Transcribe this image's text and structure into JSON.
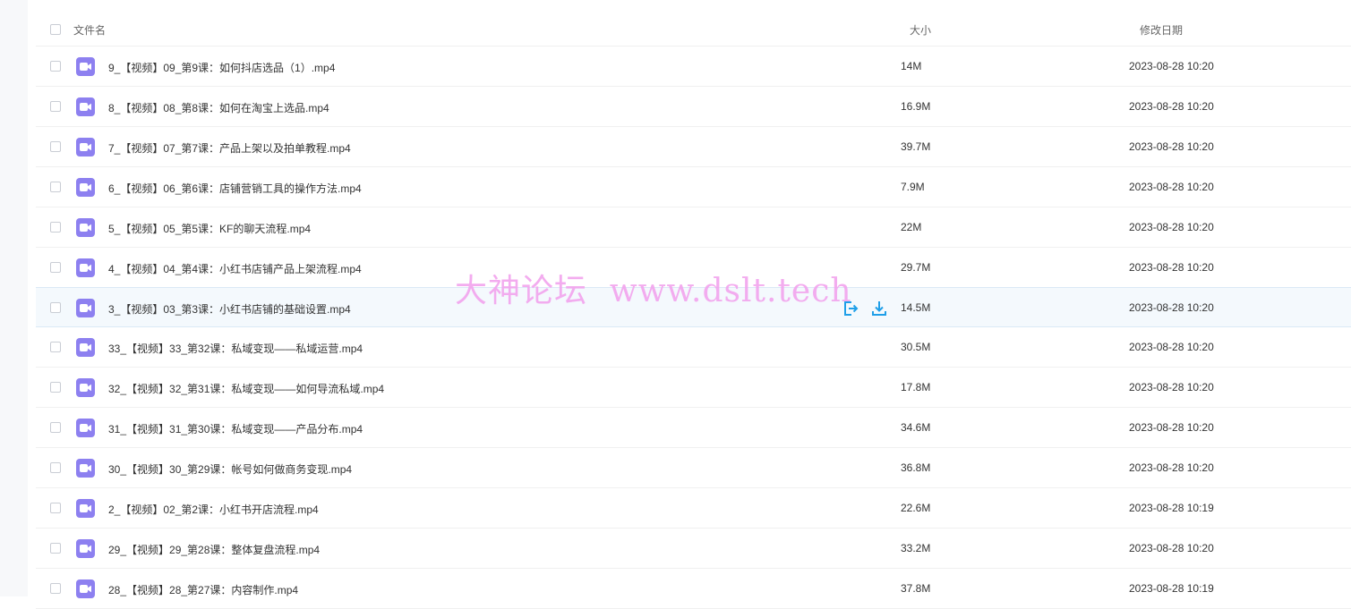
{
  "header": {
    "name_label": "文件名",
    "size_label": "大小",
    "date_label": "修改日期"
  },
  "files": [
    {
      "name": "9_【视频】09_第9课：如何抖店选品（1）.mp4",
      "size": "14M",
      "date": "2023-08-28 10:20"
    },
    {
      "name": "8_【视频】08_第8课：如何在淘宝上选品.mp4",
      "size": "16.9M",
      "date": "2023-08-28 10:20"
    },
    {
      "name": "7_【视频】07_第7课：产品上架以及拍单教程.mp4",
      "size": "39.7M",
      "date": "2023-08-28 10:20"
    },
    {
      "name": "6_【视频】06_第6课：店铺营销工具的操作方法.mp4",
      "size": "7.9M",
      "date": "2023-08-28 10:20"
    },
    {
      "name": "5_【视频】05_第5课：KF的聊天流程.mp4",
      "size": "22M",
      "date": "2023-08-28 10:20"
    },
    {
      "name": "4_【视频】04_第4课：小红书店铺产品上架流程.mp4",
      "size": "29.7M",
      "date": "2023-08-28 10:20"
    },
    {
      "name": "3_【视频】03_第3课：小红书店铺的基础设置.mp4",
      "size": "14.5M",
      "date": "2023-08-28 10:20",
      "hover": true
    },
    {
      "name": "33_【视频】33_第32课：私域变现——私域运营.mp4",
      "size": "30.5M",
      "date": "2023-08-28 10:20"
    },
    {
      "name": "32_【视频】32_第31课：私域变现——如何导流私域.mp4",
      "size": "17.8M",
      "date": "2023-08-28 10:20"
    },
    {
      "name": "31_【视频】31_第30课：私域变现——产品分布.mp4",
      "size": "34.6M",
      "date": "2023-08-28 10:20"
    },
    {
      "name": "30_【视频】30_第29课：帐号如何做商务变现.mp4",
      "size": "36.8M",
      "date": "2023-08-28 10:20"
    },
    {
      "name": "2_【视频】02_第2课：小红书开店流程.mp4",
      "size": "22.6M",
      "date": "2023-08-28 10:19"
    },
    {
      "name": "29_【视频】29_第28课：整体复盘流程.mp4",
      "size": "33.2M",
      "date": "2023-08-28 10:20"
    },
    {
      "name": "28_【视频】28_第27课：内容制作.mp4",
      "size": "37.8M",
      "date": "2023-08-28 10:19"
    }
  ],
  "row_actions": {
    "share_icon": "share-icon",
    "download_icon": "download-icon"
  },
  "watermark": "大神论坛  www.dslt.tech",
  "colors": {
    "file_icon": "#8d80f0",
    "action_accent": "#1f9fe8",
    "hover_row": "#f4f9fd",
    "watermark": "#f2a4ee"
  }
}
